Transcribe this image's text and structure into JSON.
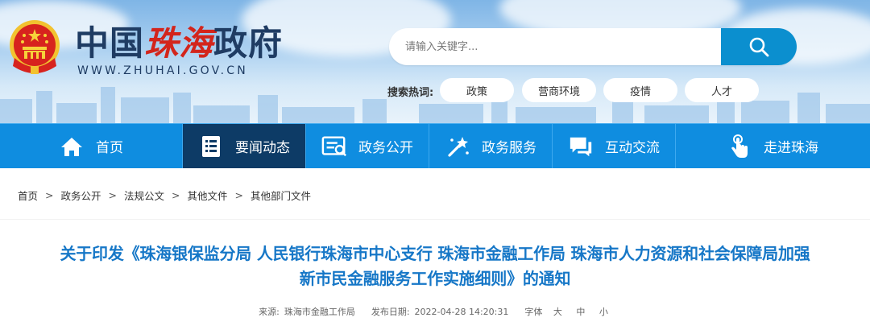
{
  "header": {
    "logo_part1": "中国",
    "logo_part2": "珠海",
    "logo_part3": "政府",
    "logo_url": "WWW.ZHUHAI.GOV.CN"
  },
  "search": {
    "placeholder": "请输入关键字...",
    "hot_label": "搜索热词:",
    "hot_tags": [
      "政策",
      "营商环境",
      "疫情",
      "人才"
    ]
  },
  "nav": {
    "items": [
      {
        "label": "首页",
        "icon": "home-icon"
      },
      {
        "label": "要闻动态",
        "icon": "news-icon"
      },
      {
        "label": "政务公开",
        "icon": "document-icon"
      },
      {
        "label": "政务服务",
        "icon": "service-icon"
      },
      {
        "label": "互动交流",
        "icon": "chat-icon"
      },
      {
        "label": "走进珠海",
        "icon": "hand-icon"
      }
    ],
    "active_index": 1
  },
  "breadcrumb": {
    "items": [
      "首页",
      "政务公开",
      "法规公文",
      "其他文件",
      "其他部门文件"
    ],
    "separator": ">"
  },
  "article": {
    "title_line1": "关于印发《珠海银保监分局 人民银行珠海市中心支行 珠海市金融工作局 珠海市人力资源和社会保障局加强",
    "title_line2": "新市民金融服务工作实施细则》的通知",
    "source_label": "来源:",
    "source": "珠海市金融工作局",
    "date_label": "发布日期:",
    "date": "2022-04-28 14:20:31",
    "font_label": "字体",
    "font_sizes": [
      "大",
      "中",
      "小"
    ]
  },
  "colors": {
    "nav_bg": "#0f8de0",
    "nav_active": "#0d3b66",
    "title": "#1677c7",
    "logo_red": "#d3251c",
    "logo_navy": "#1f3c63",
    "search_button": "#0b8fcf"
  }
}
